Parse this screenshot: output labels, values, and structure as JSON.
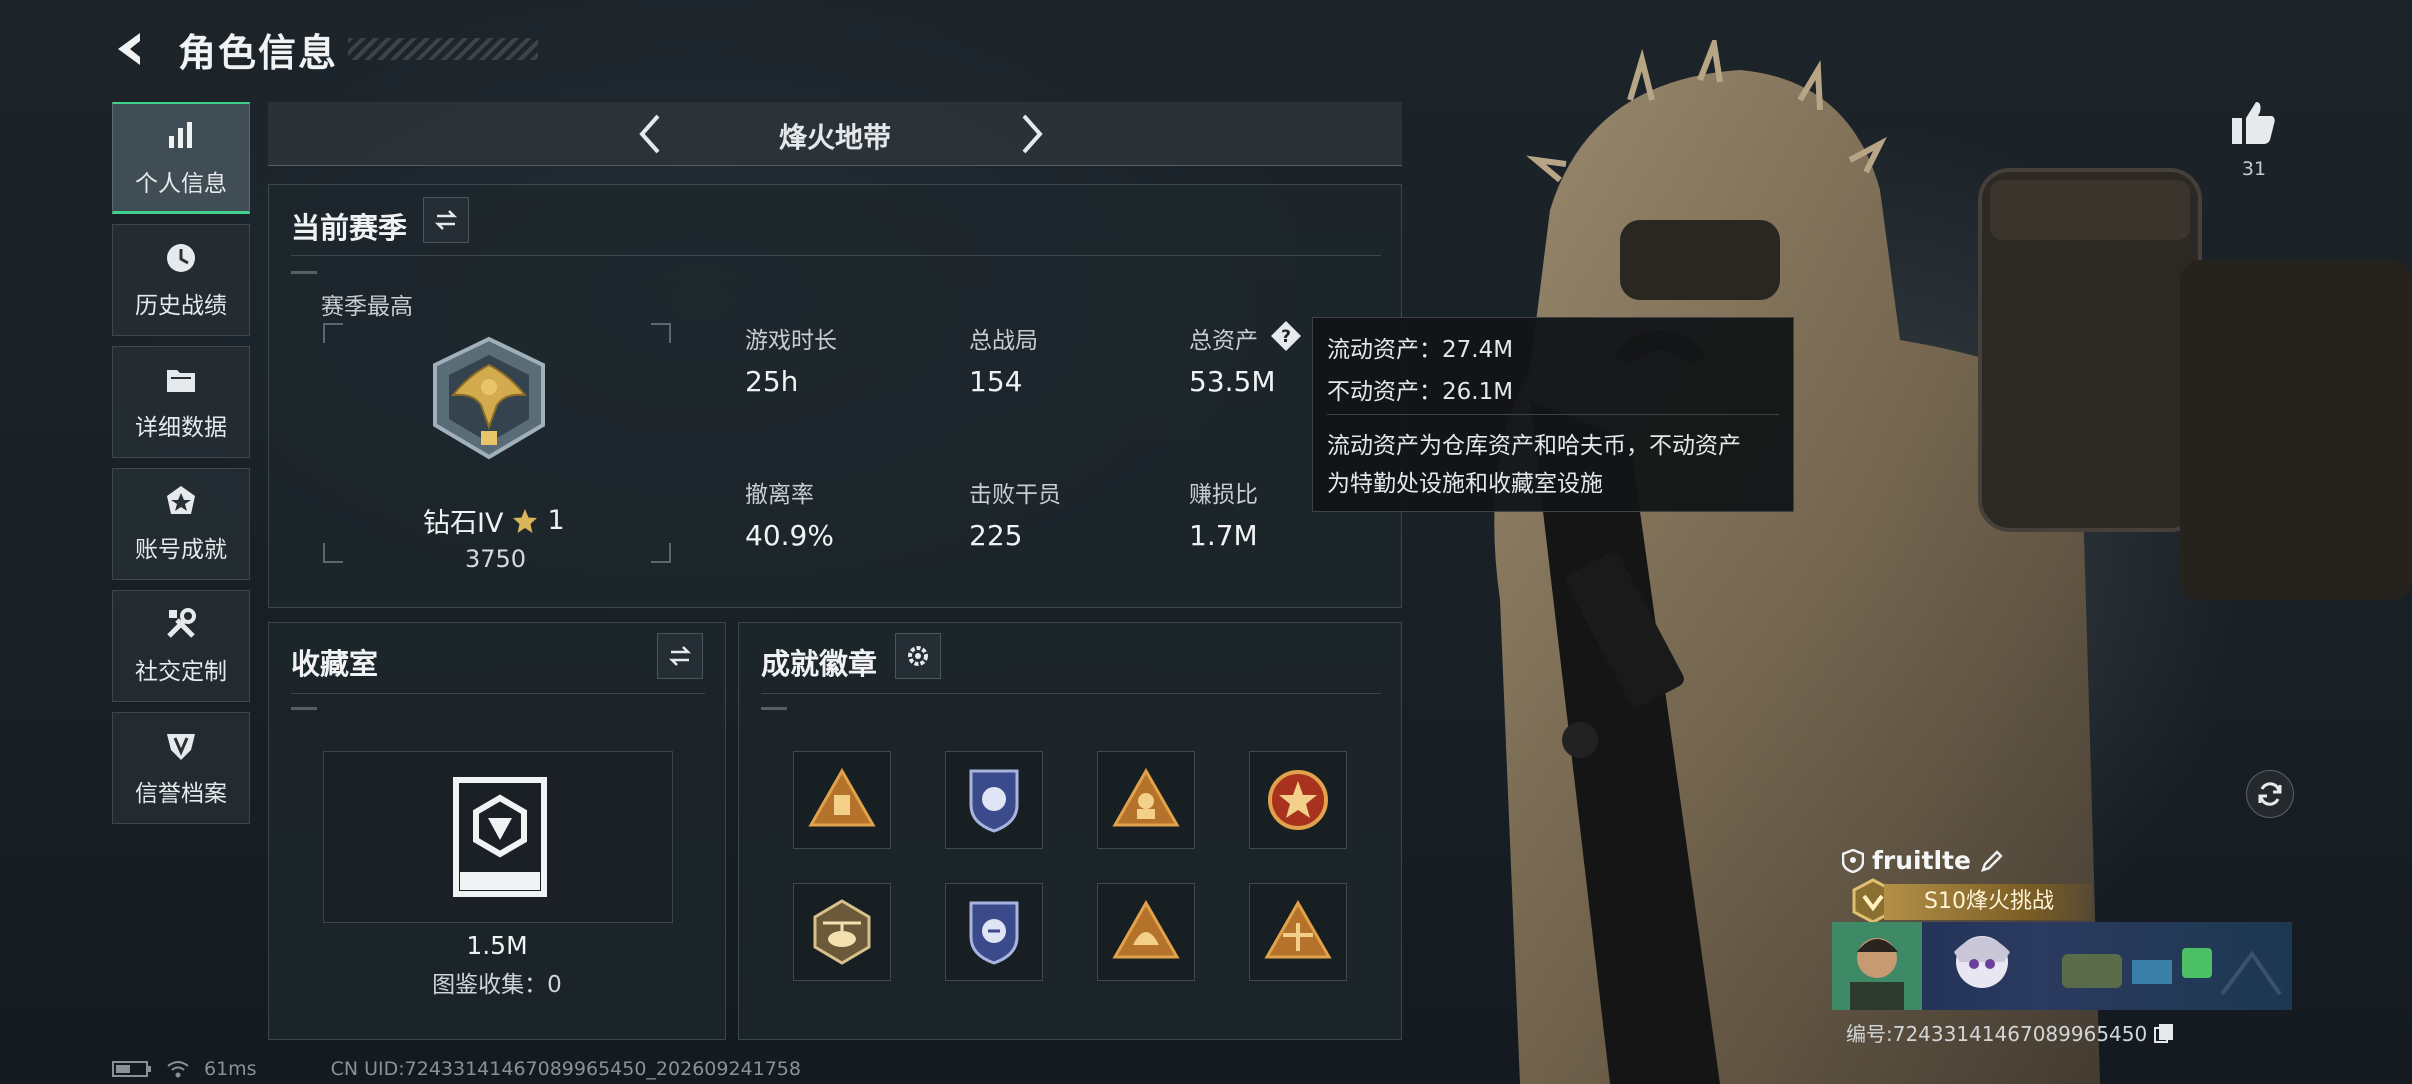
{
  "header": {
    "title": "角色信息"
  },
  "nav": [
    {
      "label": "个人信息",
      "icon": "bar-chart-icon",
      "active": true
    },
    {
      "label": "历史战绩",
      "icon": "clock-icon",
      "active": false
    },
    {
      "label": "详细数据",
      "icon": "folder-icon",
      "active": false
    },
    {
      "label": "账号成就",
      "icon": "medal-star-icon",
      "active": false
    },
    {
      "label": "社交定制",
      "icon": "tools-icon",
      "active": false
    },
    {
      "label": "信誉档案",
      "icon": "shield-wing-icon",
      "active": false
    }
  ],
  "mode": {
    "label": "烽火地带"
  },
  "season": {
    "title": "当前赛季",
    "best_label": "赛季最高",
    "rank_name": "钻石IV",
    "rank_stars": "1",
    "rank_score": "3750",
    "stats": [
      {
        "label": "游戏时长",
        "value": "25h"
      },
      {
        "label": "总战局",
        "value": "154"
      },
      {
        "label": "总资产",
        "value": "53.5M"
      },
      {
        "label": "撤离率",
        "value": "40.9%"
      },
      {
        "label": "击败干员",
        "value": "225"
      },
      {
        "label": "赚损比",
        "value": "1.7M"
      }
    ]
  },
  "tooltip": {
    "liquid": "流动资产：27.4M",
    "fixed": "不动资产：26.1M",
    "desc1": "流动资产为仓库资产和哈夫币，不动资产",
    "desc2": "为特勤处设施和收藏室设施"
  },
  "collection": {
    "title": "收藏室",
    "value": "1.5M",
    "gallery": "图鉴收集：0"
  },
  "achievements": {
    "title": "成就徽章"
  },
  "like": {
    "count": "31"
  },
  "player": {
    "name": "fruitlte",
    "title_tag": "S10烽火挑战",
    "uid": "编号:7243314146708996545​0"
  },
  "status": {
    "ping": "61ms",
    "cn_uid": "CN UID:7243314146708996545​0_202609241758"
  },
  "colors": {
    "accent_green": "#3fd08a",
    "tag_gold": "#b39048"
  }
}
